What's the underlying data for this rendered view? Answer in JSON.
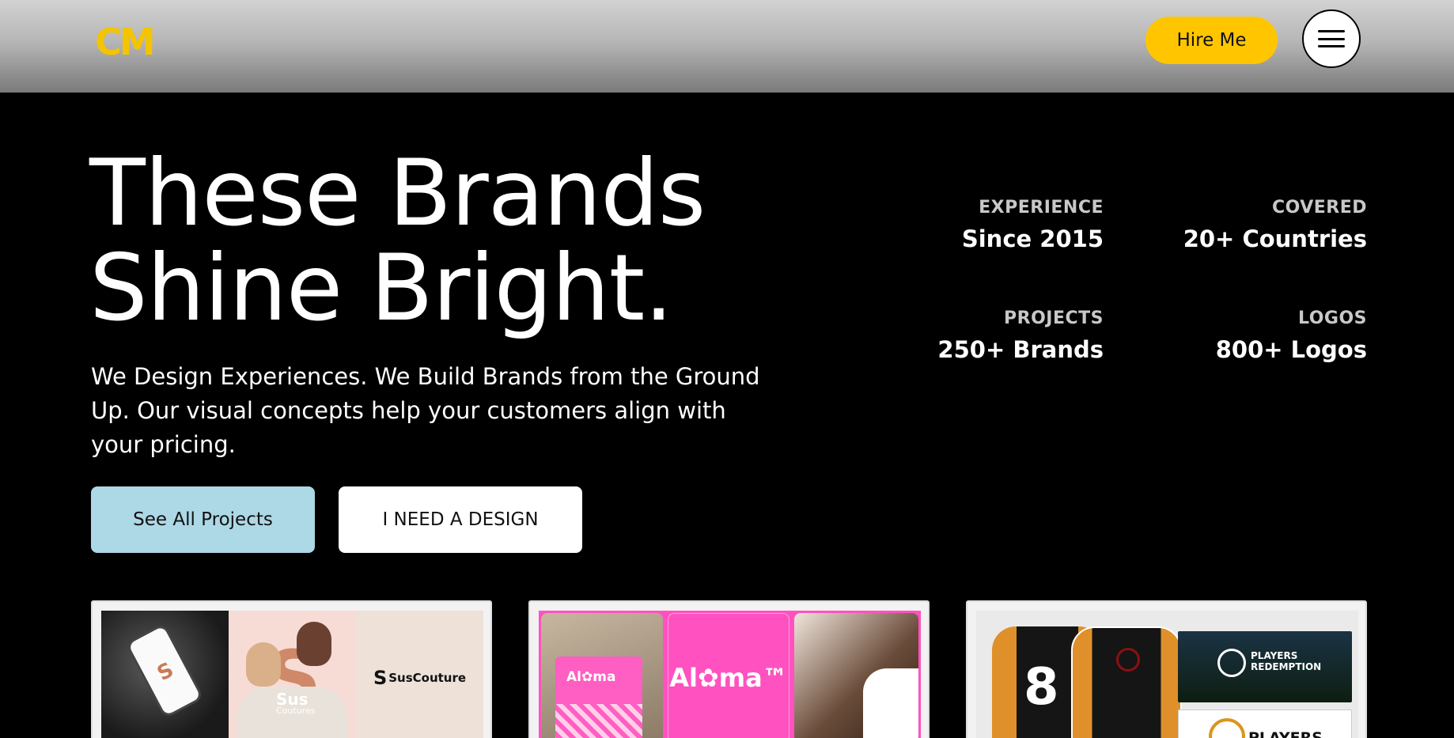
{
  "header": {
    "logo": "CM",
    "hire_label": "Hire Me",
    "menu_icon": "hamburger-menu-icon",
    "accent_color": "#ffc600"
  },
  "hero": {
    "title_line_1": "These Brands",
    "title_line_2": "Shine Bright.",
    "subtitle": "We Design Experiences. We Build Brands from the Ground Up. Our visual concepts help your customers align with your pricing.",
    "primary_button": "See All Projects",
    "secondary_button": "I NEED A DESIGN"
  },
  "stats": [
    {
      "label": "EXPERIENCE",
      "value": "Since 2015"
    },
    {
      "label": "COVERED",
      "value": "20+ Countries"
    },
    {
      "label": "PROJECTS",
      "value": "250+ Brands"
    },
    {
      "label": "LOGOS",
      "value": "800+ Logos"
    }
  ],
  "projects": [
    {
      "brand_main": "Sus",
      "brand_sub": "Coutures",
      "brand_lockup_mark": "S",
      "brand_lockup": "SusCouture"
    },
    {
      "brand": "Al✿ma™",
      "bag_text": "Al✿ma"
    },
    {
      "jersey_number": "8",
      "banner_text_1": "PLAYERS REDEMPTION",
      "banner_text_2": "PLAYERS"
    }
  ]
}
